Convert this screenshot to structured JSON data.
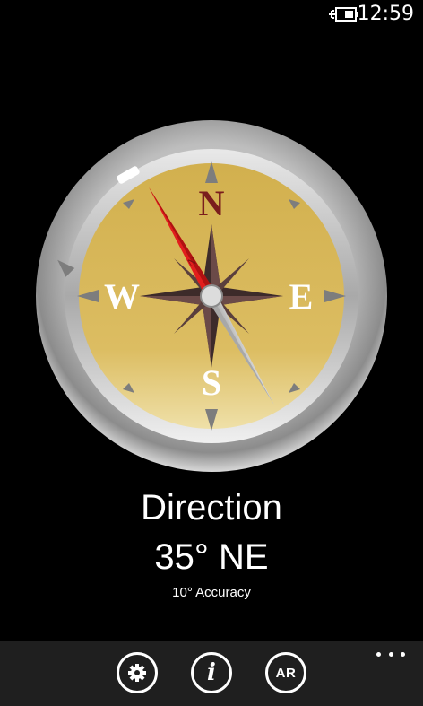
{
  "status_bar": {
    "time": "12:59",
    "battery_icon": "battery-charging-icon"
  },
  "compass": {
    "cardinals": {
      "north": "N",
      "east": "E",
      "south": "S",
      "west": "W"
    },
    "needle_label": "N",
    "heading_degrees": 35,
    "colors": {
      "face": "#d7b654",
      "needle_north": "#e21d1d",
      "needle_south": "#c9c9c9",
      "rose": "#5a3f3d",
      "north_letter": "#7a1d1d"
    }
  },
  "reading": {
    "label": "Direction",
    "value": "35° NE",
    "accuracy": "10°  Accuracy"
  },
  "app_bar": {
    "settings_icon": "gear-icon",
    "info_icon": "info-icon",
    "info_label": "i",
    "ar_label": "AR",
    "more_icon": "ellipsis-icon"
  }
}
